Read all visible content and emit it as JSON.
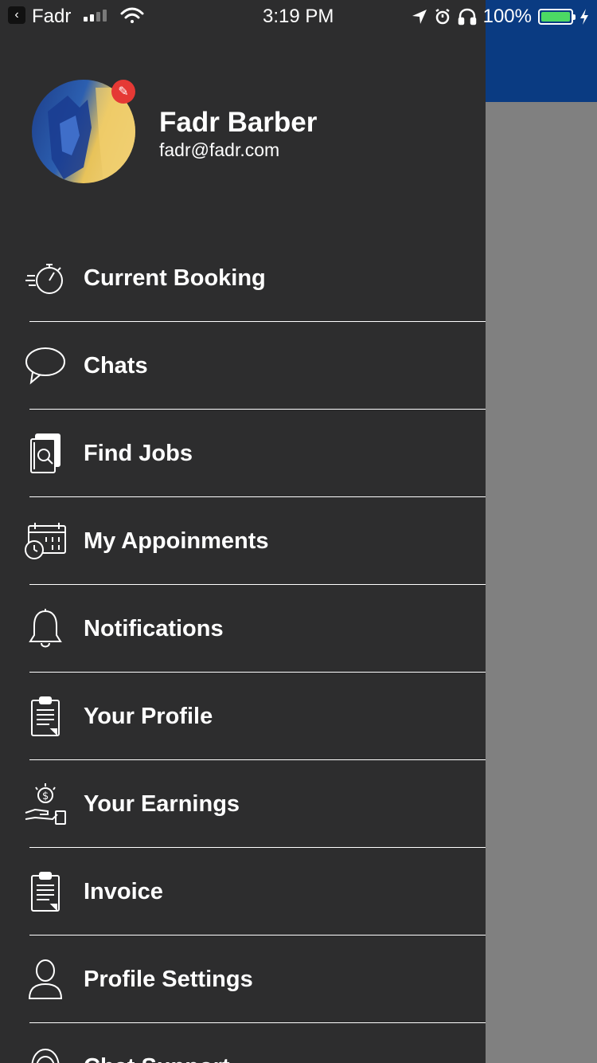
{
  "status_bar": {
    "back_app": "Fadr",
    "time": "3:19 PM",
    "battery": "100%"
  },
  "profile": {
    "name": "Fadr Barber",
    "email": "fadr@fadr.com"
  },
  "menu": {
    "items": [
      {
        "label": "Current Booking",
        "icon": "stopwatch-icon"
      },
      {
        "label": "Chats",
        "icon": "chat-bubble-icon"
      },
      {
        "label": "Find Jobs",
        "icon": "document-search-icon"
      },
      {
        "label": "My Appoinments",
        "icon": "calendar-clock-icon"
      },
      {
        "label": "Notifications",
        "icon": "bell-icon"
      },
      {
        "label": "Your Profile",
        "icon": "clipboard-icon"
      },
      {
        "label": "Your Earnings",
        "icon": "money-hand-icon"
      },
      {
        "label": "Invoice",
        "icon": "clipboard-icon"
      },
      {
        "label": "Profile Settings",
        "icon": "user-icon"
      },
      {
        "label": "Chat Support",
        "icon": "headset-icon"
      }
    ]
  },
  "colors": {
    "drawer_bg": "#2d2d2e",
    "header_blue": "#0a3b82",
    "overlay_gray": "#808080",
    "badge_red": "#e53935",
    "battery_green": "#4cd964"
  }
}
